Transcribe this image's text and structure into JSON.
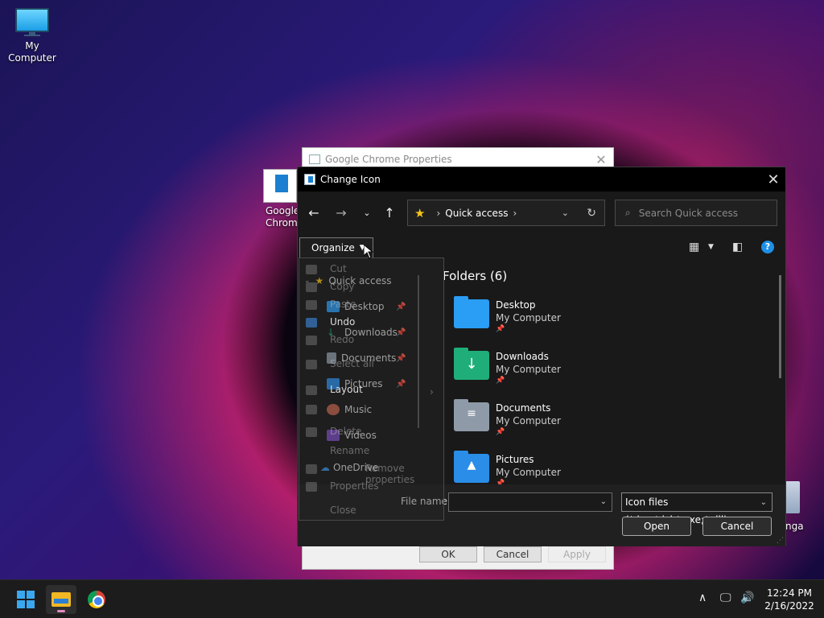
{
  "desktop": {
    "my_computer_label": "My Computer",
    "chrome_shortcut_label_1": "Google",
    "chrome_shortcut_label_2": "Chrom",
    "right_icon_label": "nga"
  },
  "props_dialog": {
    "title": "Google Chrome Properties",
    "ok_label": "OK",
    "cancel_label": "Cancel",
    "apply_label": "Apply"
  },
  "dialog": {
    "title": "Change Icon",
    "address": "Quick access",
    "search_placeholder": "Search Quick access",
    "organize_label": "Organize",
    "group_header": "Folders (6)",
    "file_name_label": "File name:",
    "file_name_value": "",
    "file_type": "Icon files (*.ico;*.icl;*.exe;*.dll)",
    "open_label": "Open",
    "cancel_label": "Cancel"
  },
  "nav_pane": {
    "items": [
      {
        "label": "Quick access"
      },
      {
        "label": "Desktop"
      },
      {
        "label": "Downloads"
      },
      {
        "label": "Documents"
      },
      {
        "label": "Pictures"
      },
      {
        "label": "Music"
      },
      {
        "label": "Videos"
      },
      {
        "label": "OneDrive"
      }
    ]
  },
  "organize_menu": {
    "items": [
      "Cut",
      "Copy",
      "Paste",
      "Undo",
      "Redo",
      "Select all",
      "Layout",
      "Delete",
      "Rename",
      "Remove properties",
      "Properties",
      "Close"
    ]
  },
  "folders": [
    {
      "name": "Desktop",
      "location": "My Computer",
      "color": "#2a9df4"
    },
    {
      "name": "Downloads",
      "location": "My Computer",
      "color": "#1fae7a"
    },
    {
      "name": "Documents",
      "location": "My Computer",
      "color": "#8e9aa8"
    },
    {
      "name": "Pictures",
      "location": "My Computer",
      "color": "#2a8de8"
    }
  ],
  "taskbar": {
    "time": "12:24 PM",
    "date": "2/16/2022"
  },
  "colors": {
    "accent": "#1e90e6",
    "quick_access_star": "#f5c518"
  }
}
